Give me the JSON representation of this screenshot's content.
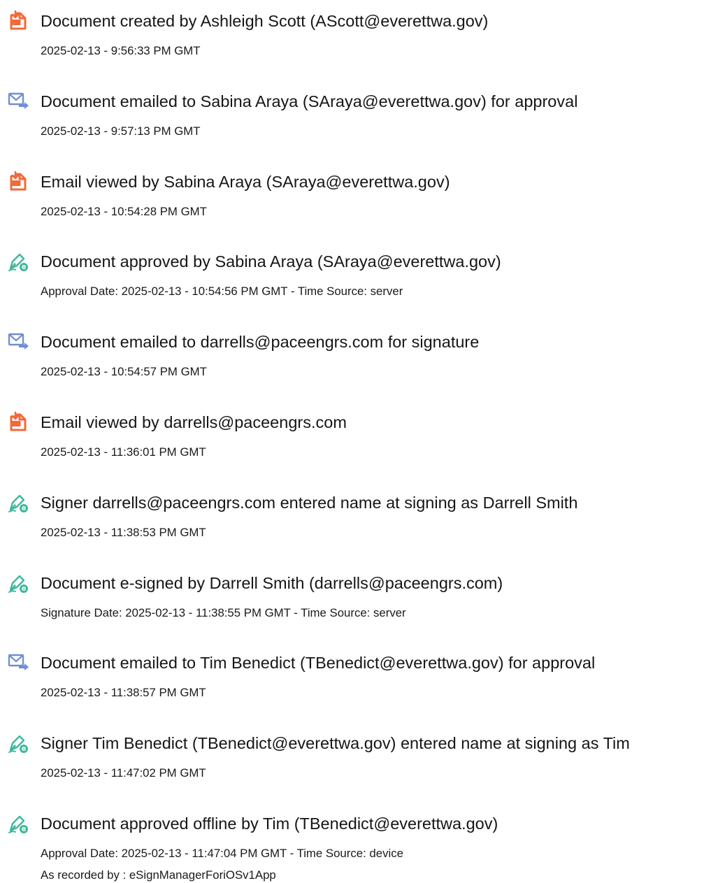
{
  "colors": {
    "created_icon": "#f06a3a",
    "email_icon": "#6f8fd6",
    "sign_icon": "#3fb79a"
  },
  "events": [
    {
      "icon": "document-created-icon",
      "title": "Document created by Ashleigh Scott (AScott@everettwa.gov)",
      "details": [
        "2025-02-13 - 9:56:33 PM GMT"
      ]
    },
    {
      "icon": "email-sent-icon",
      "title": "Document emailed to Sabina Araya (SAraya@everettwa.gov) for approval",
      "details": [
        "2025-02-13 - 9:57:13 PM GMT"
      ]
    },
    {
      "icon": "document-created-icon",
      "title": "Email viewed by Sabina Araya (SAraya@everettwa.gov)",
      "details": [
        "2025-02-13 - 10:54:28 PM GMT"
      ]
    },
    {
      "icon": "pen-sign-icon",
      "title": "Document approved by Sabina Araya (SAraya@everettwa.gov)",
      "details": [
        "Approval Date: 2025-02-13 - 10:54:56 PM GMT - Time Source: server"
      ]
    },
    {
      "icon": "email-sent-icon",
      "title": "Document emailed to darrells@paceengrs.com for signature",
      "details": [
        "2025-02-13 - 10:54:57 PM GMT"
      ]
    },
    {
      "icon": "document-created-icon",
      "title": "Email viewed by darrells@paceengrs.com",
      "details": [
        "2025-02-13 - 11:36:01 PM GMT"
      ]
    },
    {
      "icon": "pen-sign-icon",
      "title": "Signer darrells@paceengrs.com entered name at signing as Darrell Smith",
      "details": [
        "2025-02-13 - 11:38:53 PM GMT"
      ]
    },
    {
      "icon": "pen-sign-icon",
      "title": "Document e-signed by Darrell Smith (darrells@paceengrs.com)",
      "details": [
        "Signature Date: 2025-02-13 - 11:38:55 PM GMT - Time Source: server"
      ]
    },
    {
      "icon": "email-sent-icon",
      "title": "Document emailed to Tim Benedict (TBenedict@everettwa.gov) for approval",
      "details": [
        "2025-02-13 - 11:38:57 PM GMT"
      ]
    },
    {
      "icon": "pen-sign-icon",
      "title": "Signer Tim Benedict (TBenedict@everettwa.gov) entered name at signing as Tim",
      "details": [
        "2025-02-13 - 11:47:02 PM GMT"
      ]
    },
    {
      "icon": "pen-sign-icon",
      "title": "Document approved offline by Tim (TBenedict@everettwa.gov)",
      "details": [
        "Approval Date: 2025-02-13 - 11:47:04 PM GMT - Time Source: device",
        "As recorded by : eSignManagerForiOSv1App"
      ]
    }
  ]
}
